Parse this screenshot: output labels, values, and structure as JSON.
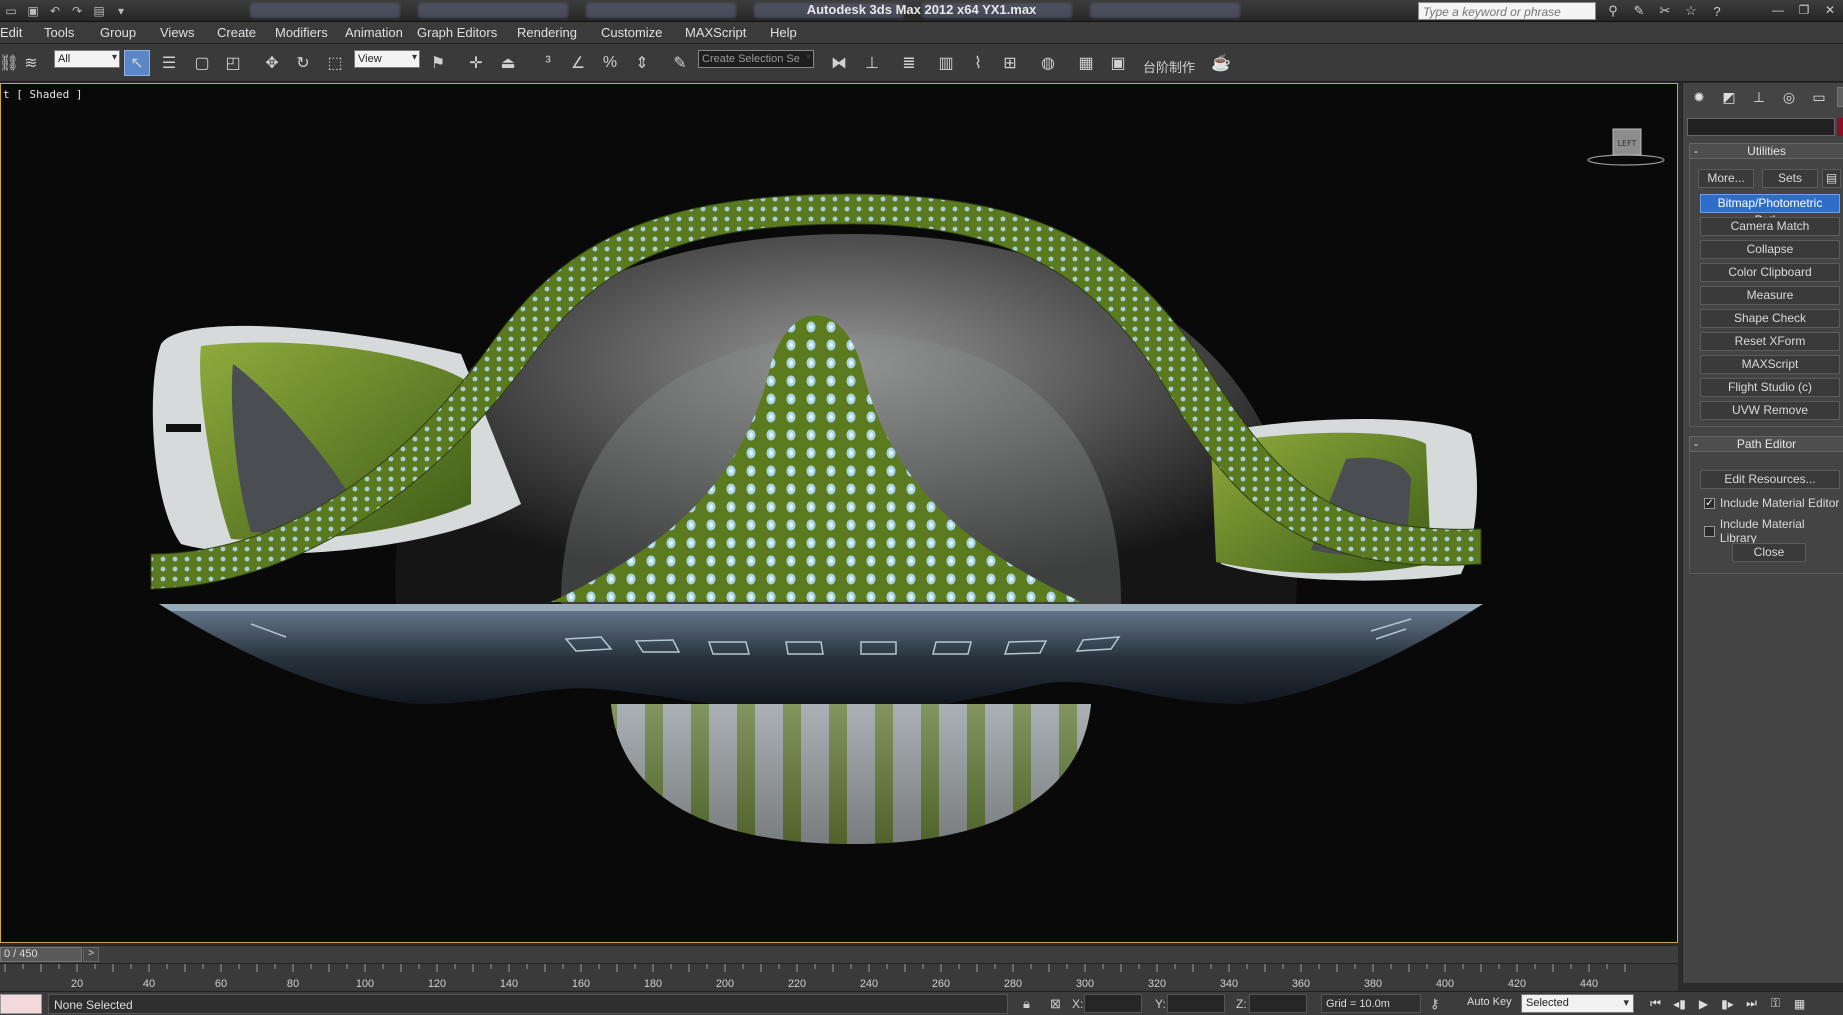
{
  "app": {
    "title": "Autodesk 3ds Max  2012 x64      YX1.max",
    "search_placeholder": "Type a keyword or phrase"
  },
  "menu": [
    "Edit",
    "Tools",
    "Group",
    "Views",
    "Create",
    "Modifiers",
    "Animation",
    "Graph Editors",
    "Rendering",
    "Customize",
    "MAXScript",
    "Help"
  ],
  "toolbar": {
    "selection_filter": "All",
    "ref_coord": "View",
    "named_selection_placeholder": "Create Selection Se",
    "chinese_label": "台阶制作"
  },
  "viewport": {
    "label": "t [ Shaded ]",
    "viewcube_label": "LEFT"
  },
  "command_panel": {
    "active_tab": "Utilities",
    "utilities": {
      "header": "Utilities",
      "more_label": "More...",
      "sets_label": "Sets",
      "buttons": [
        "Bitmap/Photometric Paths",
        "Camera Match",
        "Collapse",
        "Color Clipboard",
        "Measure",
        "Shape Check",
        "Reset XForm",
        "MAXScript",
        "Flight Studio (c)",
        "UVW Remove"
      ],
      "selected": "Bitmap/Photometric Paths"
    },
    "path_editor": {
      "header": "Path Editor",
      "edit_resources_label": "Edit Resources...",
      "include_material_editor": "Include Material Editor",
      "include_material_editor_checked": true,
      "include_material_library": "Include Material Library",
      "include_material_library_checked": false,
      "close_label": "Close"
    }
  },
  "timeline": {
    "frame_display": "0 / 450",
    "next_label": ">",
    "ticks": [
      20,
      40,
      60,
      80,
      100,
      120,
      140,
      160,
      180,
      200,
      220,
      240,
      260,
      280,
      300,
      320,
      340,
      360,
      380,
      400,
      420,
      440
    ]
  },
  "status": {
    "prompt": "None Selected",
    "x_label": "X:",
    "y_label": "Y:",
    "z_label": "Z:",
    "grid": "Grid = 10.0m",
    "autokey_label": "Auto Key",
    "key_filter": "Selected"
  }
}
